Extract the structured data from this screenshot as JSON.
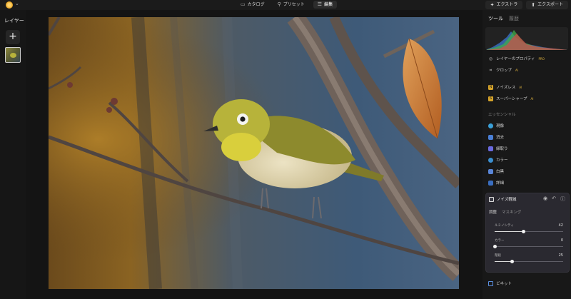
{
  "modes": [
    {
      "label": "カタログ",
      "icon": "folder-icon"
    },
    {
      "label": "プリセット",
      "icon": "magic-icon"
    },
    {
      "label": "編集",
      "icon": "sliders-icon",
      "active": true
    }
  ],
  "topright": {
    "extras_label": "エクストラ",
    "export_label": "エクスポート"
  },
  "layers": {
    "title": "レイヤー",
    "add": "+"
  },
  "right": {
    "tabs": [
      {
        "label": "ツール",
        "active": true
      },
      {
        "label": "履歴",
        "active": false
      }
    ],
    "tools": [
      {
        "label": "レイヤーのプロパティ",
        "icon": "layer-props-icon",
        "pro": "PRO"
      },
      {
        "label": "クロップ",
        "icon": "crop-icon",
        "pro": "AI"
      },
      {
        "label": "ノイズレス",
        "icon": "noiseless-icon",
        "pro": "AI"
      },
      {
        "label": "スーパーシャープ",
        "icon": "supersharp-icon",
        "pro": "AI"
      }
    ],
    "section": "エッセンシャル",
    "essentials": [
      {
        "label": "現像",
        "color": "#3aa0d8"
      },
      {
        "label": "消去",
        "color": "#4a7fd6"
      },
      {
        "label": "縁取り",
        "color": "#6a6ae0"
      },
      {
        "label": "カラー",
        "color": "#3b8fd0"
      },
      {
        "label": "白黒",
        "color": "#5a86d8"
      },
      {
        "label": "詳細",
        "color": "#3a6ec0"
      }
    ],
    "panel": {
      "title": "ノイズ軽減",
      "tabs": [
        "調整",
        "マスキング"
      ],
      "sliders": [
        {
          "label": "ルミノシティ",
          "value": "42",
          "level": 0.42
        },
        {
          "label": "カラー",
          "value": "0",
          "level": 0.0
        },
        {
          "label": "階段",
          "value": "25",
          "level": 0.25
        }
      ]
    },
    "vignette": "ビネット"
  }
}
